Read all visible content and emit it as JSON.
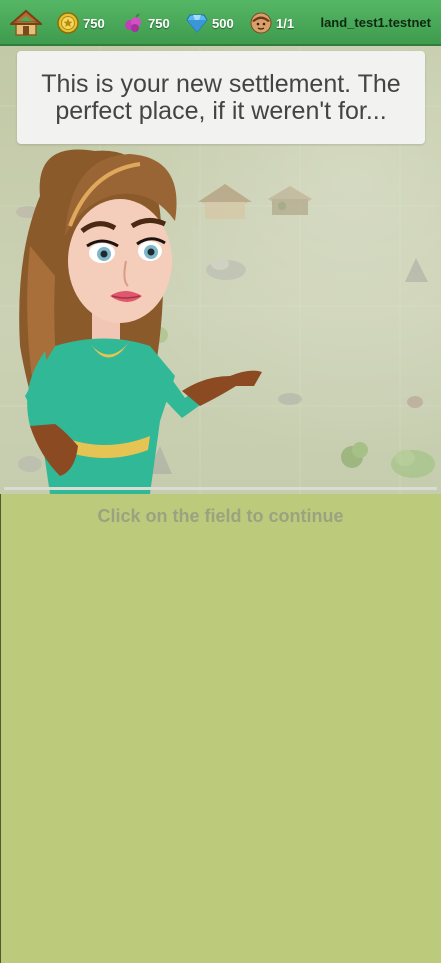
{
  "topbar": {
    "resources": [
      {
        "name": "coins",
        "value": "750",
        "icon": "coin-icon"
      },
      {
        "name": "gems",
        "value": "750",
        "icon": "berry-icon"
      },
      {
        "name": "diamonds",
        "value": "500",
        "icon": "diamond-icon"
      },
      {
        "name": "population",
        "value": "1/1",
        "icon": "villager-icon"
      }
    ],
    "username": "land_test1.testnet",
    "home_icon": "house-icon"
  },
  "dialog": {
    "text": "This is your new settlement. The perfect place, if it weren't for..."
  },
  "hint": "Click on the field to continue",
  "colors": {
    "topbar": "#4caf5c",
    "field": "#bccb7b",
    "dialog_bg": "#f2f3f0",
    "hint": "#9aa27f",
    "character_dress": "#31b896"
  }
}
